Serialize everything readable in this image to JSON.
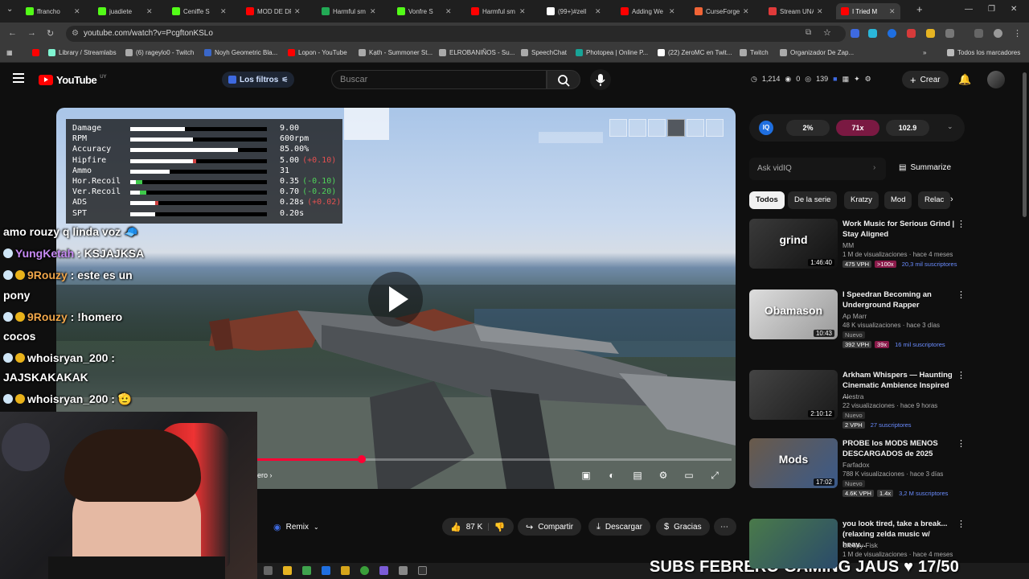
{
  "browser": {
    "tabs": [
      {
        "label": "ffrancho",
        "color": "#53fc18"
      },
      {
        "label": "juadiete",
        "color": "#53fc18"
      },
      {
        "label": "Ceniffe S",
        "color": "#53fc18"
      },
      {
        "label": "MOD DE DR",
        "color": "#ff0000"
      },
      {
        "label": "Harmful sm",
        "color": "#22aa55"
      },
      {
        "label": "Vonfre S",
        "color": "#53fc18"
      },
      {
        "label": "Harmful sm",
        "color": "#ff0000"
      },
      {
        "label": "(99+)#zell",
        "color": "#ffffff"
      },
      {
        "label": "Adding We",
        "color": "#ff0000"
      },
      {
        "label": "CurseForge",
        "color": "#f16436"
      },
      {
        "label": "Stream UNA",
        "color": "#e03a3a"
      },
      {
        "label": "I Tried M",
        "color": "#ff0000"
      }
    ],
    "url": "youtube.com/watch?v=PcgftonKSLo",
    "bookmarks": [
      {
        "label": "Library / Streamlabs",
        "color": "#80f5d2"
      },
      {
        "label": "(6) rageylo0 - Twitch",
        "color": "#aaaaaa"
      },
      {
        "label": "Noyh Geometric Bla...",
        "color": "#3a67c9"
      },
      {
        "label": "Lopon - YouTube",
        "color": "#ff0000"
      },
      {
        "label": "Kạth - Summoner St...",
        "color": "#aaaaaa"
      },
      {
        "label": "ELROBANIÑOS - Su...",
        "color": "#aaaaaa"
      },
      {
        "label": "SpeechChat",
        "color": "#aaaaaa"
      },
      {
        "label": "Photopea | Online P...",
        "color": "#18a497"
      },
      {
        "label": "(22) ZeroMC en Twit...",
        "color": "#ffffff"
      },
      {
        "label": "Twitch",
        "color": "#aaaaaa"
      },
      {
        "label": "Organizador De Zap...",
        "color": "#aaaaaa"
      }
    ],
    "all_bookmarks": "Todos los marcadores"
  },
  "header": {
    "logo": "YouTube",
    "country": "UY",
    "filters_label": "Los filtros",
    "search_placeholder": "Buscar",
    "stat_views": "1,214",
    "stat_a": "0",
    "stat_b": "139",
    "create_label": "Crear"
  },
  "player": {
    "weapon_stats": [
      {
        "name": "Damage",
        "value": "9.00",
        "mod": "",
        "mod_kind": "",
        "fill": 0.4
      },
      {
        "name": "RPM",
        "value": "600rpm",
        "mod": "",
        "mod_kind": "",
        "fill": 0.46
      },
      {
        "name": "Accuracy",
        "value": "85.00%",
        "mod": "",
        "mod_kind": "",
        "fill": 0.79
      },
      {
        "name": "Hipfire",
        "value": "5.00",
        "mod": "(+0.10)",
        "mod_kind": "pos",
        "fill": 0.46
      },
      {
        "name": "Ammo",
        "value": "31",
        "mod": "",
        "mod_kind": "",
        "fill": 0.29
      },
      {
        "name": "Hor.Recoil",
        "value": "0.35",
        "mod": "(-0.10)",
        "mod_kind": "neg",
        "fill": 0.04
      },
      {
        "name": "Ver.Recoil",
        "value": "0.70",
        "mod": "(-0.20)",
        "mod_kind": "neg",
        "fill": 0.07
      },
      {
        "name": "ADS",
        "value": "0.28s",
        "mod": "(+0.02)",
        "mod_kind": "pos",
        "fill": 0.18
      },
      {
        "name": "SPT",
        "value": "0.20s",
        "mod": "",
        "mod_kind": "",
        "fill": 0.18
      }
    ],
    "progress": 0.22,
    "chapter": "ero"
  },
  "chat": [
    {
      "user": "",
      "text": "amo rouzy q linda voz 🧢",
      "user_style": "white"
    },
    {
      "user": "YungKetah",
      "text": " : KSJAJKSA",
      "user_style": "purple"
    },
    {
      "user": "9Rouzy",
      "text": " : este es un",
      "user_style": "orange"
    },
    {
      "user": "",
      "text": "pony",
      "user_style": "white"
    },
    {
      "user": "9Rouzy",
      "text": " : !homero",
      "user_style": "orange"
    },
    {
      "user": "",
      "text": "cocos",
      "user_style": "white"
    },
    {
      "user": "whoisryan_200",
      "text": " :",
      "user_style": "white"
    },
    {
      "user": "",
      "text": "JAJSKAKAKAK",
      "user_style": "white"
    },
    {
      "user": "whoisryan_200",
      "text": " : 🫡",
      "user_style": "white"
    }
  ],
  "actions": {
    "remix": "Remix",
    "likes": "87 K",
    "share": "Compartir",
    "download": "Descargar",
    "thanks": "Gracias"
  },
  "banner": "SUBS FEBRERO GAMING JAUS ♥ 17/50",
  "sidebar": {
    "vidiq": {
      "logo": "IQ",
      "pct": "2%",
      "score": "71x",
      "vph": "102.9"
    },
    "ask_placeholder": "Ask vidIQ",
    "summarize": "Summarize",
    "chips": [
      "Todos",
      "De la serie",
      "Kratzy",
      "Mod",
      "Relac"
    ],
    "recommendations": [
      {
        "title": "Work Music for Serious Grind | Stay Aligned",
        "channel": "MM",
        "meta": "1 M de visualizaciones · hace 4 meses",
        "duration": "1:46:40",
        "thumb_text": "grind",
        "tag1": "475 VPH",
        "tag2": ">100x",
        "tag3": "20,3 mil suscriptores",
        "nuevo": ""
      },
      {
        "title": "I Speedran Becoming an Underground Rapper",
        "channel": "Ap Marr",
        "meta": "48 K visualizaciones · hace 3 días",
        "duration": "10:43",
        "thumb_text": "Obamason",
        "tag1": "392 VPH",
        "tag2": "39x",
        "tag3": "16 mil suscriptores",
        "nuevo": "Nuevo"
      },
      {
        "title": "Arkham Whispers — Haunting Cinematic Ambience Inspired ...",
        "channel": "Alestra",
        "meta": "22 visualizaciones · hace 9 horas",
        "duration": "2:10:12",
        "thumb_text": "",
        "tag1": "2 VPH",
        "tag2": "",
        "tag3": "27 suscriptores",
        "nuevo": "Nuevo"
      },
      {
        "title": "PROBE los MODS MENOS DESCARGADOS de 2025",
        "channel": "Farfadox",
        "meta": "788 K visualizaciones · hace 3 días",
        "duration": "17:02",
        "thumb_text": "Mods",
        "tag1": "4.6K VPH",
        "tag2": "1.4x",
        "tag3": "3,2 M suscriptores",
        "nuevo": "Nuevo"
      },
      {
        "title": "you look tired, take a break... (relaxing zelda music w/ heav...",
        "channel": "Sleepy Fisk",
        "meta": "1 M de visualizaciones · hace 4 meses",
        "duration": "",
        "thumb_text": "",
        "tag1": "",
        "tag2": "",
        "tag3": "",
        "nuevo": ""
      }
    ]
  }
}
